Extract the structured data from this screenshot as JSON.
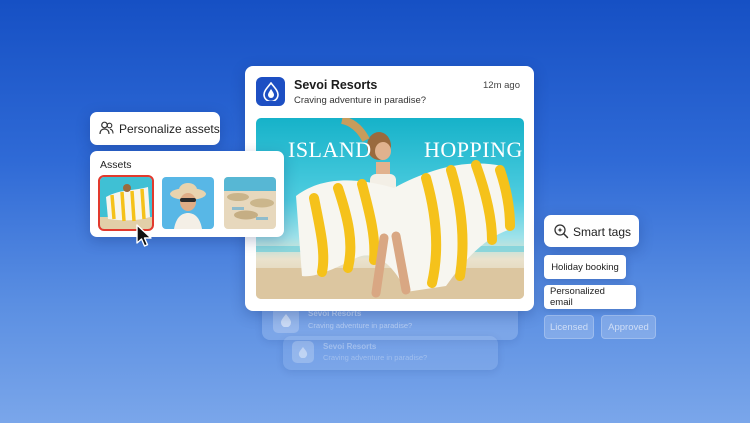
{
  "notification": {
    "brand_icon": "flame-drop-icon",
    "title": "Sevoi Resorts",
    "subtitle": "Craving adventure in paradise?",
    "time": "12m ago",
    "hero": {
      "word_left": "ISLAND",
      "word_right": "HOPPING"
    }
  },
  "ghost_notifications": [
    {
      "title": "Sevoi Resorts",
      "subtitle": "Craving adventure in paradise?"
    },
    {
      "title": "Sevoi Resorts",
      "subtitle": "Craving adventure in paradise?"
    }
  ],
  "personalize": {
    "icon": "people-icon",
    "label": "Personalize assets"
  },
  "assets": {
    "header": "Assets",
    "thumbnails": [
      "towel-beach-thumbnail",
      "sunhat-portrait-thumbnail",
      "beach-umbrellas-thumbnail"
    ],
    "selected_index": 0
  },
  "smart_tags": {
    "icon": "smart-tag-icon",
    "label": "Smart tags",
    "tags": [
      "Holiday booking",
      "Personalized email"
    ],
    "faded_tags": [
      "Licensed",
      "Approved"
    ]
  },
  "colors": {
    "brand": "#1d4fc3",
    "selection": "#e23a2e",
    "towel_stripe": "#f5c21b"
  }
}
